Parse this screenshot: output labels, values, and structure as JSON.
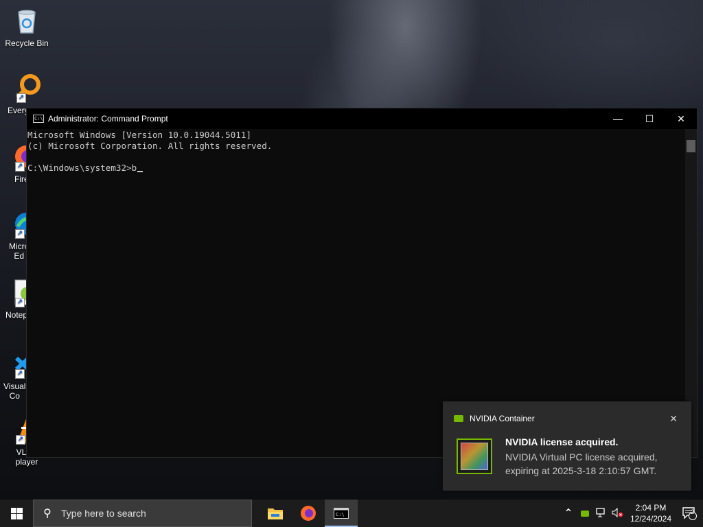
{
  "desktop": {
    "icons": [
      {
        "label": "Recycle Bin",
        "icon": "recycle-bin-icon"
      },
      {
        "label": "Every",
        "icon": "everything-search-icon"
      },
      {
        "label": "Fire",
        "icon": "firefox-icon"
      },
      {
        "label": "Micro\nEd",
        "icon": "edge-icon"
      },
      {
        "label": "Notep",
        "icon": "notepad-plus-icon"
      },
      {
        "label": "Visual\nCo",
        "icon": "vscode-icon"
      },
      {
        "label": "VLC r\nplayer",
        "icon": "vlc-icon"
      }
    ]
  },
  "cmd": {
    "title": "Administrator: Command Prompt",
    "lines": [
      "Microsoft Windows [Version 10.0.19044.5011]",
      "(c) Microsoft Corporation. All rights reserved.",
      "",
      "C:\\Windows\\system32>b"
    ],
    "buttons": {
      "minimize": "—",
      "maximize": "☐",
      "close": "✕"
    }
  },
  "notification": {
    "app": "NVIDIA Container",
    "title": "NVIDIA license acquired.",
    "body": "NVIDIA Virtual PC license acquired, expiring at 2025-3-18 2:10:57 GMT.",
    "close": "✕",
    "accent": "#76b900"
  },
  "taskbar": {
    "search_placeholder": "Type here to search",
    "apps": [
      "file-explorer-icon",
      "firefox-icon",
      "cmd-icon"
    ],
    "tray": {
      "chevron": "^",
      "time": "2:04 PM",
      "date": "12/24/2024",
      "notification_count": "2"
    }
  }
}
